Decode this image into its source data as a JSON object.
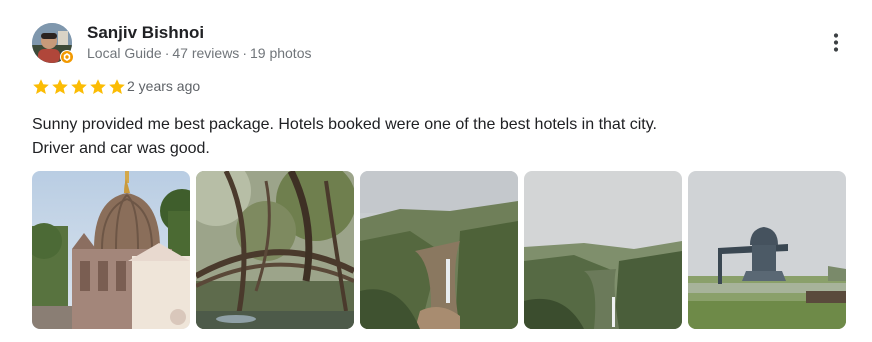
{
  "review": {
    "reviewer_name": "Sanjiv Bishnoi",
    "reviewer_meta": {
      "role": "Local Guide",
      "reviews": "47 reviews",
      "photos": "19 photos",
      "separator": "·"
    },
    "rating": 5,
    "rating_max": 5,
    "date": "2 years ago",
    "text_lines": [
      "Sunny provided me best package. Hotels booked were one of the best hotels in that city.",
      "Driver and car was good."
    ],
    "photos": [
      {
        "subject": "temple-dome-photo"
      },
      {
        "subject": "living-root-bridge-photo"
      },
      {
        "subject": "waterfall-gorge-photo"
      },
      {
        "subject": "valley-waterfall-photo"
      },
      {
        "subject": "shiva-statue-photo"
      }
    ]
  },
  "colors": {
    "star": "#fbbc04",
    "star_empty": "#dadce0",
    "name": "#202124",
    "meta": "#70757a",
    "text": "#202124"
  },
  "icons": {
    "more": "more-vert-icon",
    "star": "star-icon",
    "local_guide": "local-guide-badge-icon"
  }
}
